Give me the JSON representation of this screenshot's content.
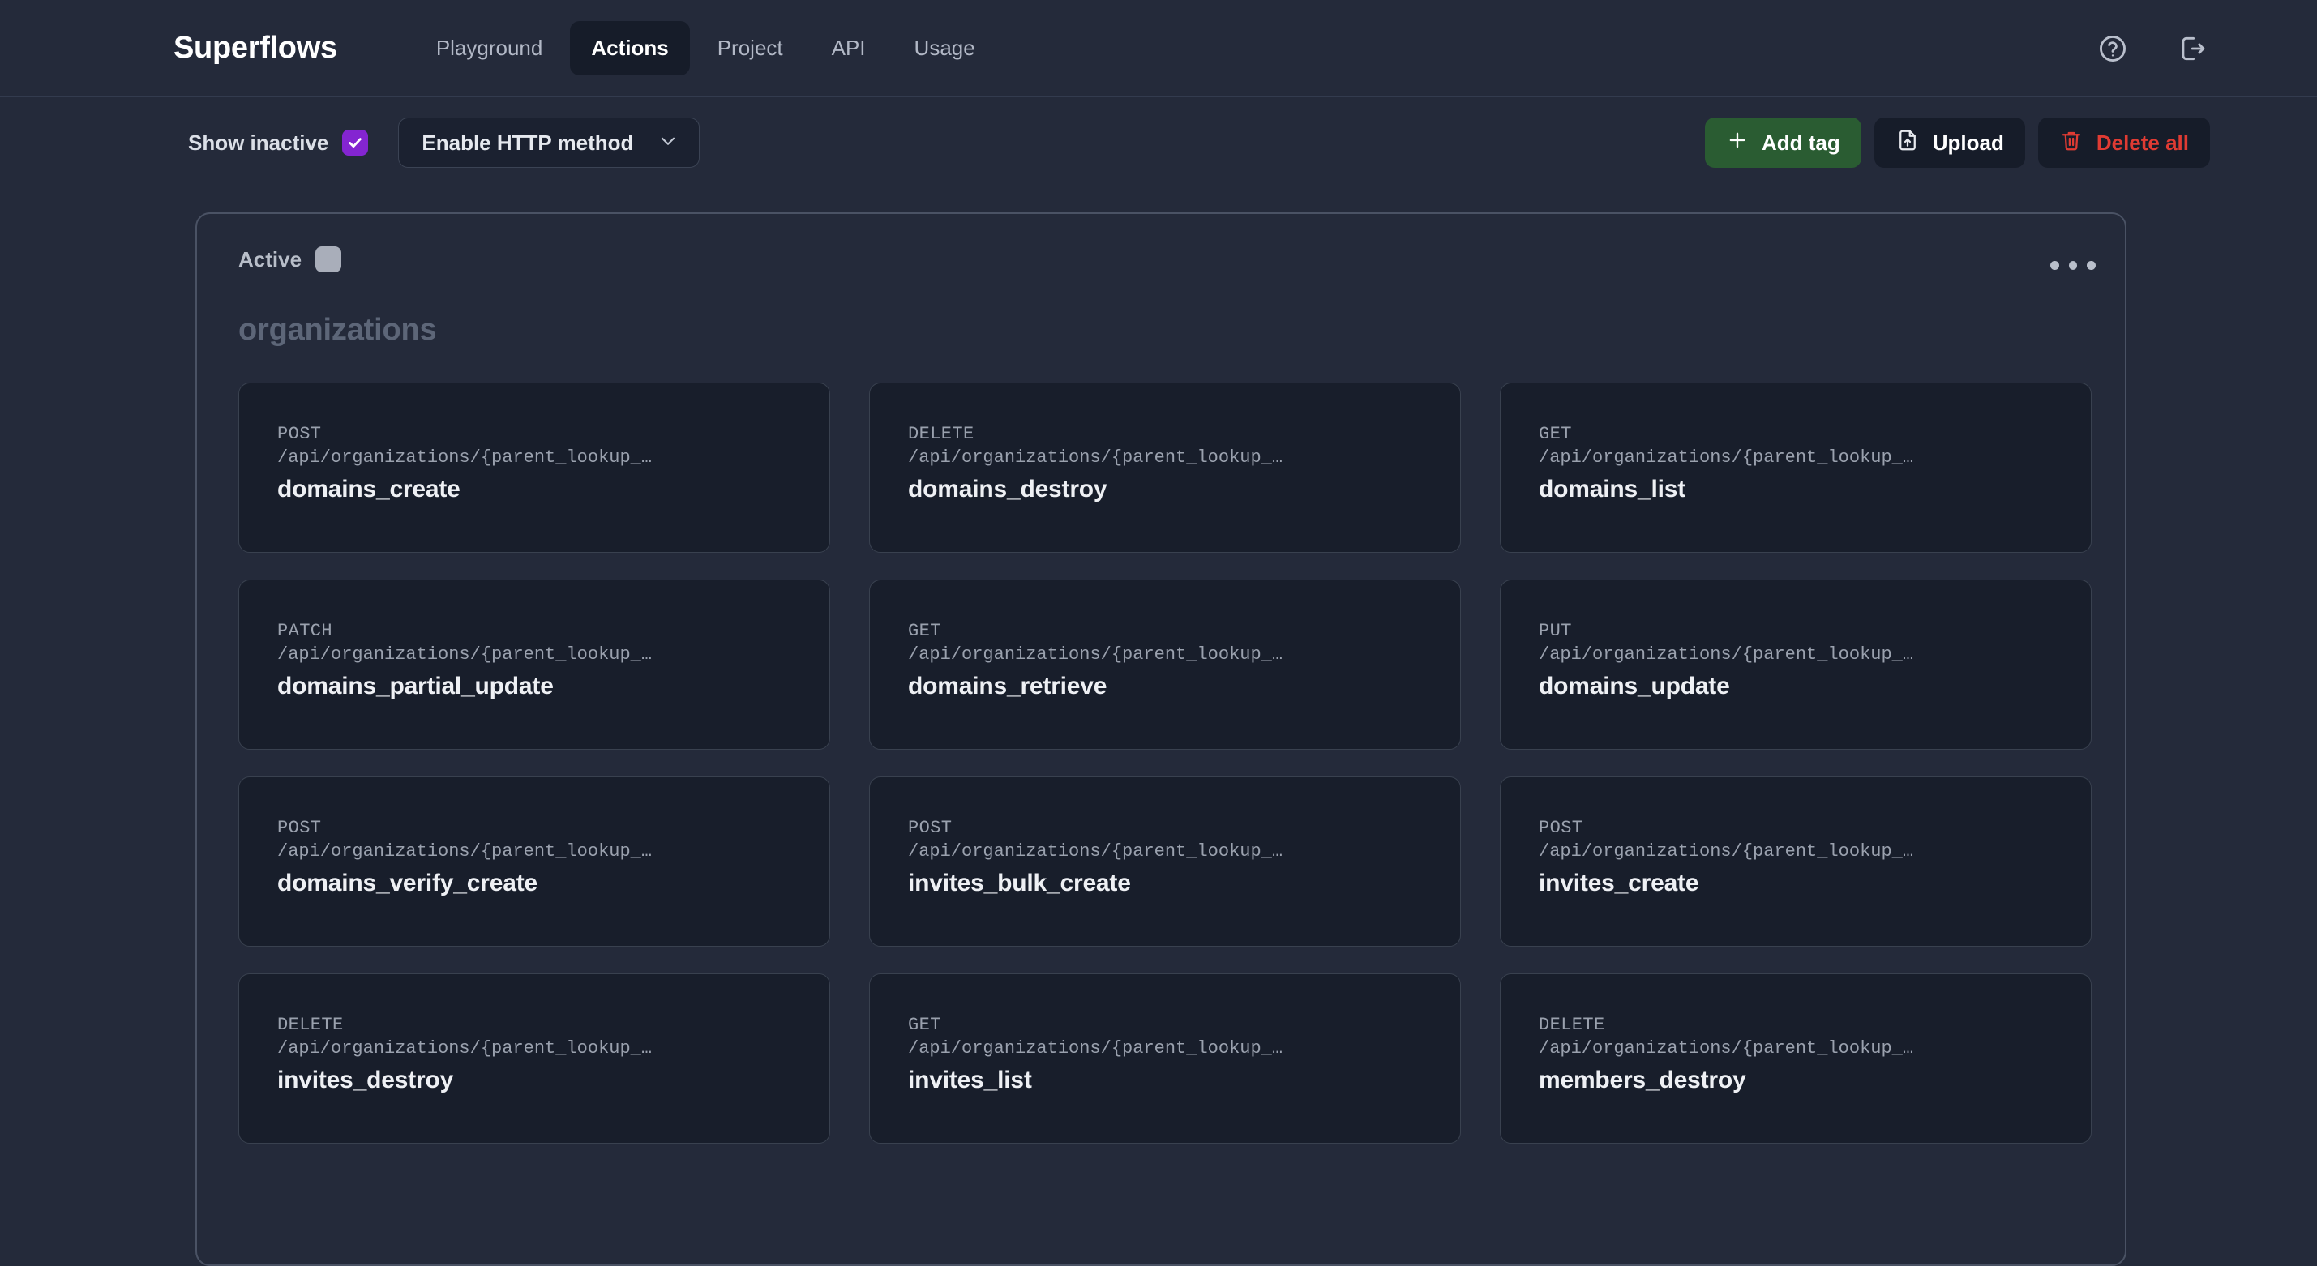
{
  "header": {
    "brand": "Superflows",
    "tabs": [
      {
        "label": "Playground",
        "active": false
      },
      {
        "label": "Actions",
        "active": true
      },
      {
        "label": "Project",
        "active": false
      },
      {
        "label": "API",
        "active": false
      },
      {
        "label": "Usage",
        "active": false
      }
    ],
    "icons": [
      {
        "name": "help-circle-icon",
        "title": "Help"
      },
      {
        "name": "logout-icon",
        "title": "Log out"
      }
    ]
  },
  "toolbar": {
    "show_inactive_label": "Show inactive",
    "show_inactive_checked": true,
    "http_method_select": "Enable HTTP method",
    "add_tag_label": "Add tag",
    "upload_label": "Upload",
    "delete_all_label": "Delete all"
  },
  "colors": {
    "page_background": "#242a3a",
    "card_background": "#181e2b",
    "checkbox_checked": "#8425d1",
    "checkbox_unchecked": "#a9aeba",
    "add_tag_green": "#2a5c32",
    "delete_red": "#e03b33",
    "panel_border": "#4a5264"
  },
  "panel": {
    "active_label": "Active",
    "active_checked": false,
    "menu_icon": "ellipsis-icon",
    "tag_title": "organizations",
    "actions": [
      {
        "method": "POST",
        "path": "/api/organizations/{parent_lookup_…",
        "name": "domains_create"
      },
      {
        "method": "DELETE",
        "path": "/api/organizations/{parent_lookup_…",
        "name": "domains_destroy"
      },
      {
        "method": "GET",
        "path": "/api/organizations/{parent_lookup_…",
        "name": "domains_list"
      },
      {
        "method": "PATCH",
        "path": "/api/organizations/{parent_lookup_…",
        "name": "domains_partial_update"
      },
      {
        "method": "GET",
        "path": "/api/organizations/{parent_lookup_…",
        "name": "domains_retrieve"
      },
      {
        "method": "PUT",
        "path": "/api/organizations/{parent_lookup_…",
        "name": "domains_update"
      },
      {
        "method": "POST",
        "path": "/api/organizations/{parent_lookup_…",
        "name": "domains_verify_create"
      },
      {
        "method": "POST",
        "path": "/api/organizations/{parent_lookup_…",
        "name": "invites_bulk_create"
      },
      {
        "method": "POST",
        "path": "/api/organizations/{parent_lookup_…",
        "name": "invites_create"
      },
      {
        "method": "DELETE",
        "path": "/api/organizations/{parent_lookup_…",
        "name": "invites_destroy"
      },
      {
        "method": "GET",
        "path": "/api/organizations/{parent_lookup_…",
        "name": "invites_list"
      },
      {
        "method": "DELETE",
        "path": "/api/organizations/{parent_lookup_…",
        "name": "members_destroy"
      }
    ]
  }
}
